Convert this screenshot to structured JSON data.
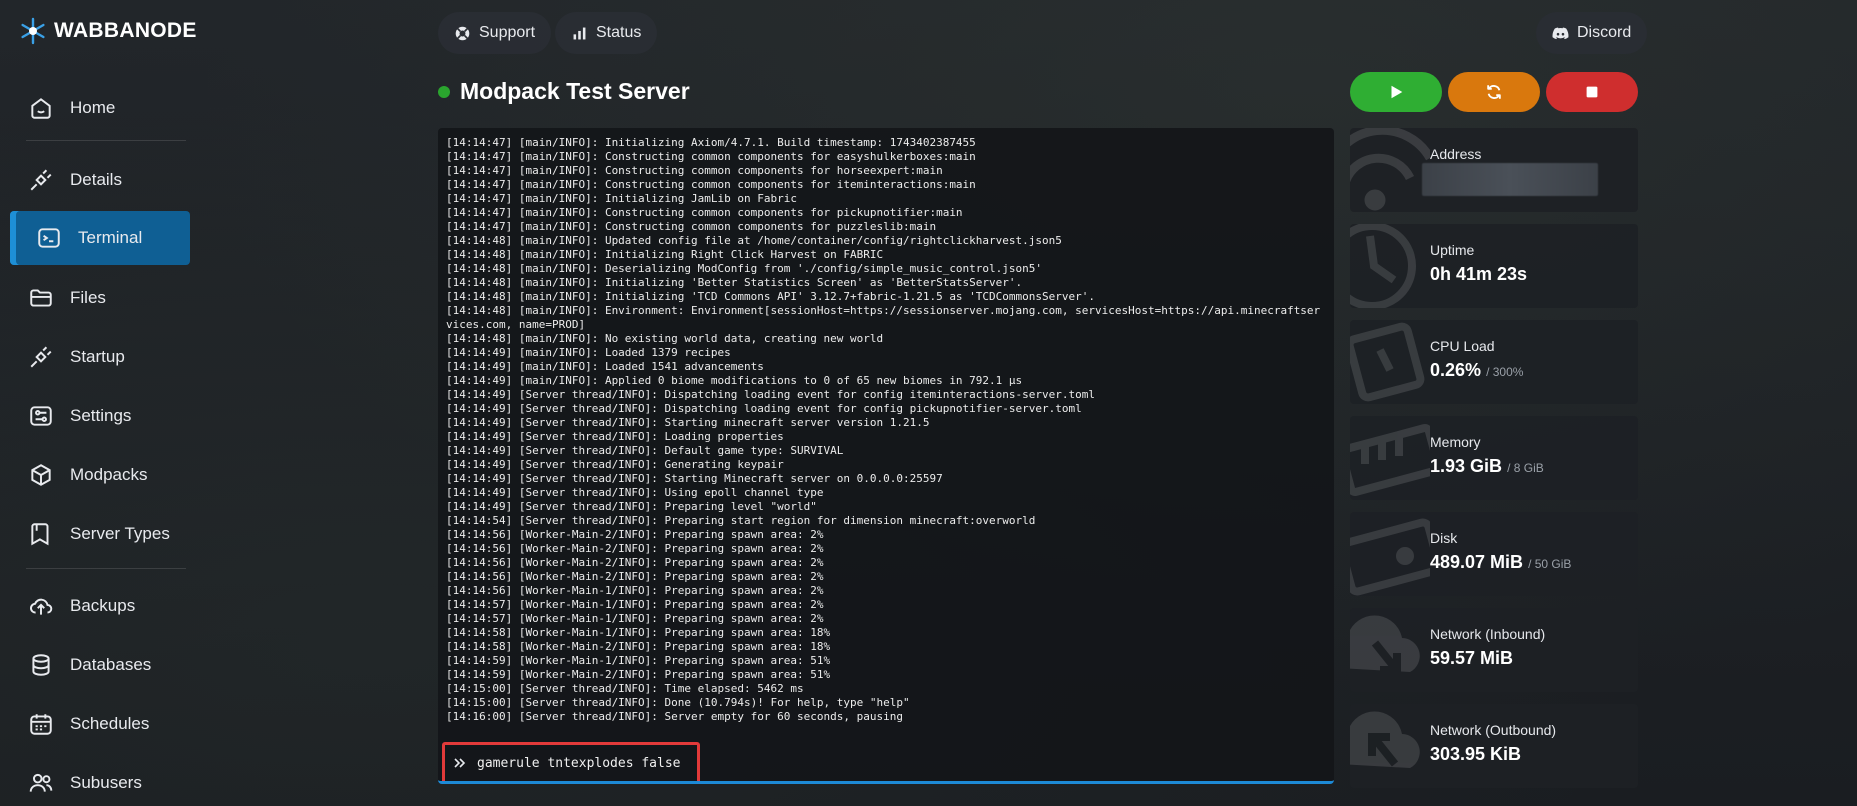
{
  "brand": {
    "name": "WABBANODE",
    "logo_icon": "snowflake-logo"
  },
  "sidebar": {
    "items": [
      {
        "label": "Home",
        "icon": "home-icon"
      },
      {
        "label": "Details",
        "icon": "plug-icon"
      },
      {
        "label": "Terminal",
        "icon": "terminal-icon",
        "active": true
      },
      {
        "label": "Files",
        "icon": "folder-icon"
      },
      {
        "label": "Startup",
        "icon": "plug-icon"
      },
      {
        "label": "Settings",
        "icon": "sliders-icon"
      },
      {
        "label": "Modpacks",
        "icon": "box-icon"
      },
      {
        "label": "Server Types",
        "icon": "bookmark-icon"
      },
      {
        "label": "Backups",
        "icon": "cloud-upload-icon"
      },
      {
        "label": "Databases",
        "icon": "database-icon"
      },
      {
        "label": "Schedules",
        "icon": "calendar-icon"
      },
      {
        "label": "Subusers",
        "icon": "users-icon"
      }
    ]
  },
  "topbar": {
    "support_label": "Support",
    "status_label": "Status",
    "discord_label": "Discord"
  },
  "server": {
    "name": "Modpack Test Server",
    "status_color": "#2aa52e"
  },
  "power": {
    "start_color": "#2fae33",
    "restart_color": "#d9780d",
    "stop_color": "#cf2e2e"
  },
  "console": {
    "lines": [
      "[14:14:47] [main/INFO]: Initializing Axiom/4.7.1. Build timestamp: 1743402387455",
      "[14:14:47] [main/INFO]: Constructing common components for easyshulkerboxes:main",
      "[14:14:47] [main/INFO]: Constructing common components for horseexpert:main",
      "[14:14:47] [main/INFO]: Constructing common components for iteminteractions:main",
      "[14:14:47] [main/INFO]: Initializing JamLib on Fabric",
      "[14:14:47] [main/INFO]: Constructing common components for pickupnotifier:main",
      "[14:14:47] [main/INFO]: Constructing common components for puzzleslib:main",
      "[14:14:48] [main/INFO]: Updated config file at /home/container/config/rightclickharvest.json5",
      "[14:14:48] [main/INFO]: Initializing Right Click Harvest on FABRIC",
      "[14:14:48] [main/INFO]: Deserializing ModConfig from './config/simple_music_control.json5'",
      "[14:14:48] [main/INFO]: Initializing 'Better Statistics Screen' as 'BetterStatsServer'.",
      "[14:14:48] [main/INFO]: Initializing 'TCD Commons API' 3.12.7+fabric-1.21.5 as 'TCDCommonsServer'.",
      "[14:14:48] [main/INFO]: Environment: Environment[sessionHost=https://sessionserver.mojang.com, servicesHost=https://api.minecraftservices.com, name=PROD]",
      "[14:14:48] [main/INFO]: No existing world data, creating new world",
      "[14:14:49] [main/INFO]: Loaded 1379 recipes",
      "[14:14:49] [main/INFO]: Loaded 1541 advancements",
      "[14:14:49] [main/INFO]: Applied 0 biome modifications to 0 of 65 new biomes in 792.1 µs",
      "[14:14:49] [Server thread/INFO]: Dispatching loading event for config iteminteractions-server.toml",
      "[14:14:49] [Server thread/INFO]: Dispatching loading event for config pickupnotifier-server.toml",
      "[14:14:49] [Server thread/INFO]: Starting minecraft server version 1.21.5",
      "[14:14:49] [Server thread/INFO]: Loading properties",
      "[14:14:49] [Server thread/INFO]: Default game type: SURVIVAL",
      "[14:14:49] [Server thread/INFO]: Generating keypair",
      "[14:14:49] [Server thread/INFO]: Starting Minecraft server on 0.0.0.0:25597",
      "[14:14:49] [Server thread/INFO]: Using epoll channel type",
      "[14:14:49] [Server thread/INFO]: Preparing level \"world\"",
      "[14:14:54] [Server thread/INFO]: Preparing start region for dimension minecraft:overworld",
      "[14:14:56] [Worker-Main-2/INFO]: Preparing spawn area: 2%",
      "[14:14:56] [Worker-Main-2/INFO]: Preparing spawn area: 2%",
      "[14:14:56] [Worker-Main-2/INFO]: Preparing spawn area: 2%",
      "[14:14:56] [Worker-Main-2/INFO]: Preparing spawn area: 2%",
      "[14:14:56] [Worker-Main-1/INFO]: Preparing spawn area: 2%",
      "[14:14:57] [Worker-Main-1/INFO]: Preparing spawn area: 2%",
      "[14:14:57] [Worker-Main-1/INFO]: Preparing spawn area: 2%",
      "[14:14:58] [Worker-Main-1/INFO]: Preparing spawn area: 18%",
      "[14:14:58] [Worker-Main-2/INFO]: Preparing spawn area: 18%",
      "[14:14:59] [Worker-Main-1/INFO]: Preparing spawn area: 51%",
      "[14:14:59] [Worker-Main-2/INFO]: Preparing spawn area: 51%",
      "[14:15:00] [Server thread/INFO]: Time elapsed: 5462 ms",
      "[14:15:00] [Server thread/INFO]: Done (10.794s)! For help, type \"help\"",
      "[14:16:00] [Server thread/INFO]: Server empty for 60 seconds, pausing"
    ],
    "input_value": "gamerule tntexplodes false",
    "highlight_color": "#e23a3a"
  },
  "stats": {
    "address": {
      "label": "Address"
    },
    "uptime": {
      "label": "Uptime",
      "value": "0h 41m 23s"
    },
    "cpu": {
      "label": "CPU Load",
      "value": "0.26%",
      "limit": "/ 300%"
    },
    "memory": {
      "label": "Memory",
      "value": "1.93 GiB",
      "limit": "/ 8 GiB"
    },
    "disk": {
      "label": "Disk",
      "value": "489.07 MiB",
      "limit": "/ 50 GiB"
    },
    "net_in": {
      "label": "Network (Inbound)",
      "value": "59.57 MiB"
    },
    "net_out": {
      "label": "Network (Outbound)",
      "value": "303.95 KiB"
    }
  }
}
